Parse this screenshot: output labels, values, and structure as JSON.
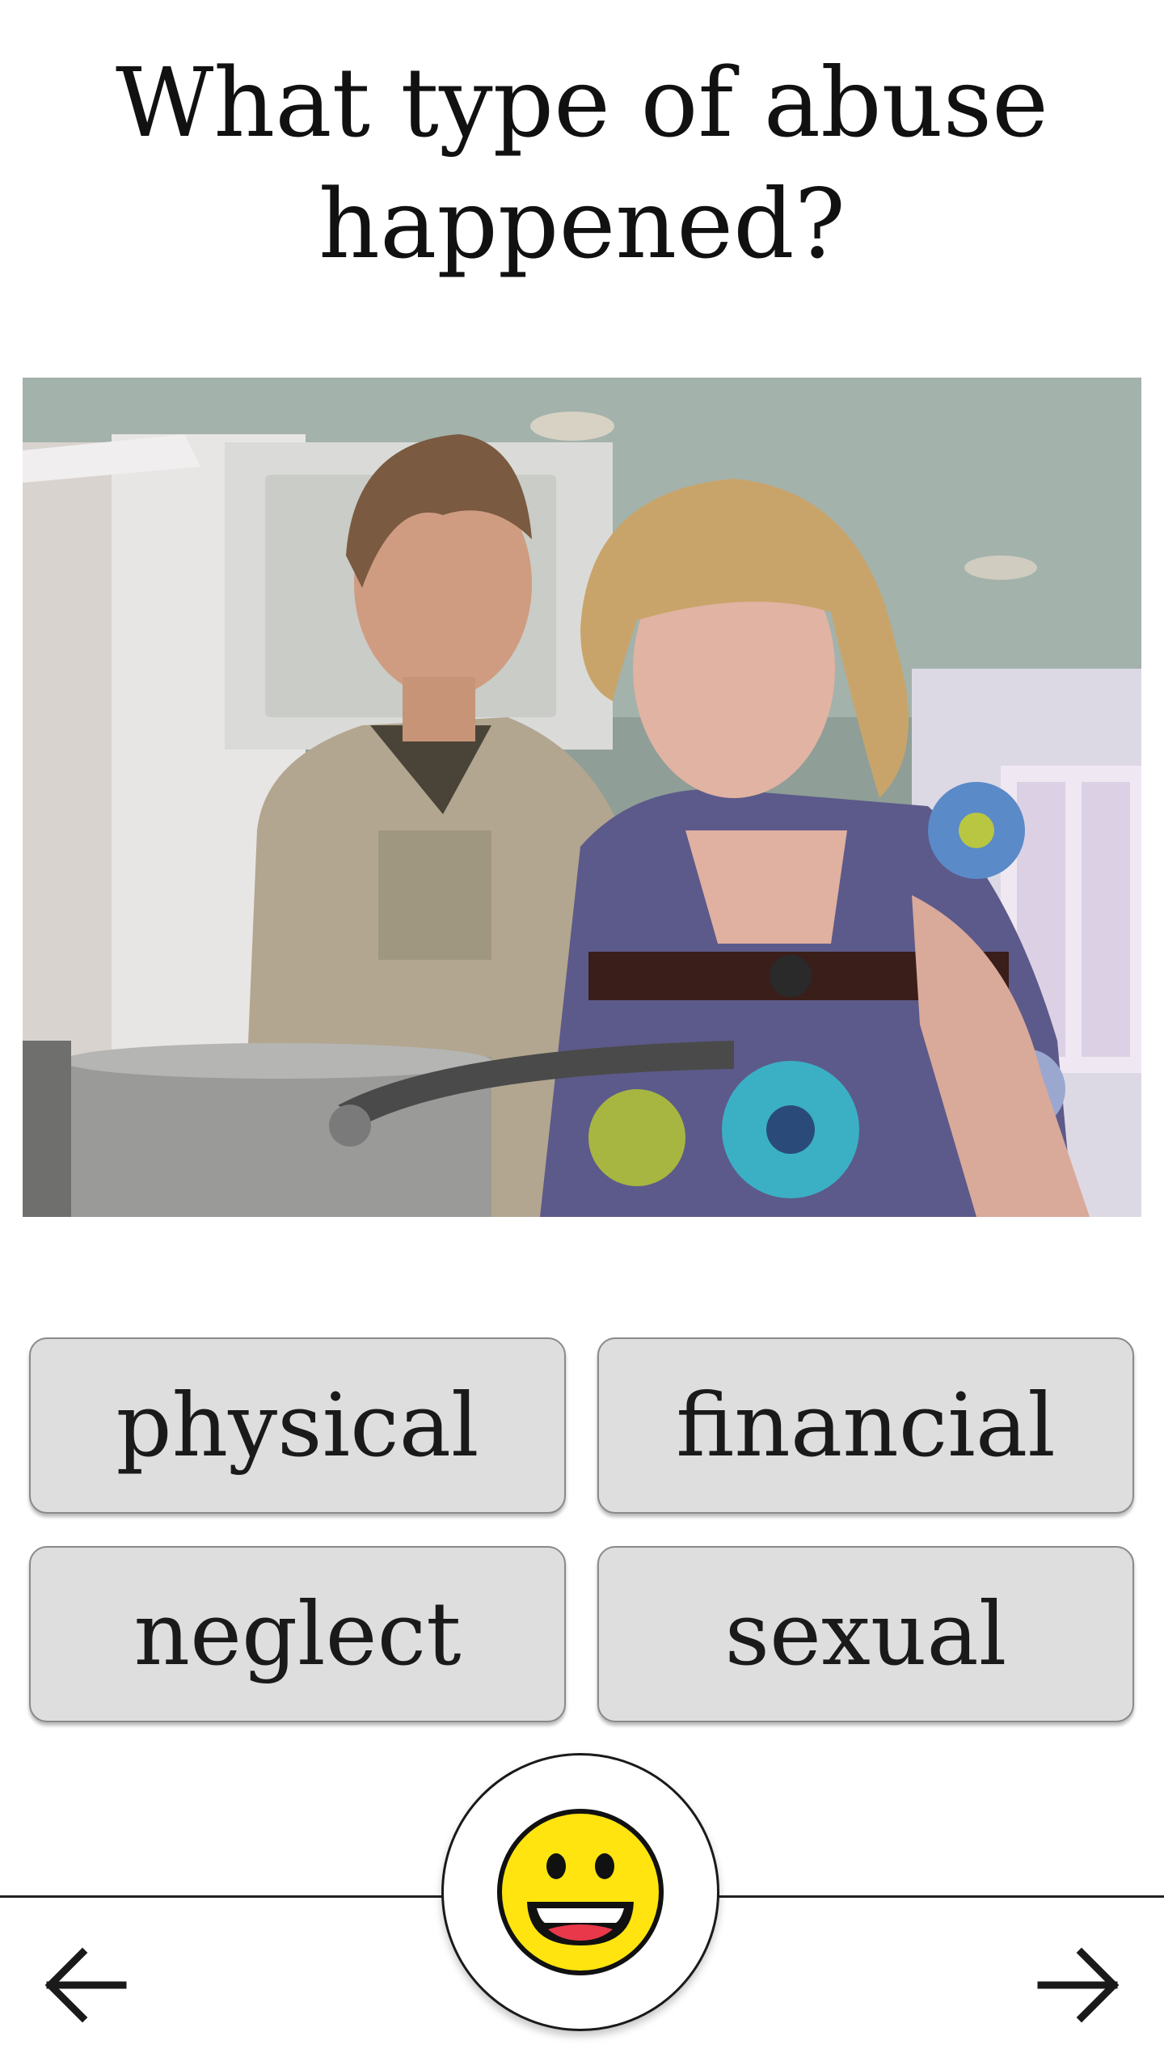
{
  "question": {
    "line1": "What type of abuse",
    "line2": "happened?"
  },
  "image": {
    "subject": "photo-man-woman-kitchen"
  },
  "answers": [
    {
      "label": "physical"
    },
    {
      "label": "financial"
    },
    {
      "label": "neglect"
    },
    {
      "label": "sexual"
    }
  ],
  "navigation": {
    "back_icon": "arrow-left-icon",
    "next_icon": "arrow-right-icon",
    "feedback_icon": "smiling-face-icon"
  },
  "colors": {
    "button_bg": "#dedede",
    "button_border": "#8a8a8a",
    "emoji_face": "#ffe40f"
  }
}
